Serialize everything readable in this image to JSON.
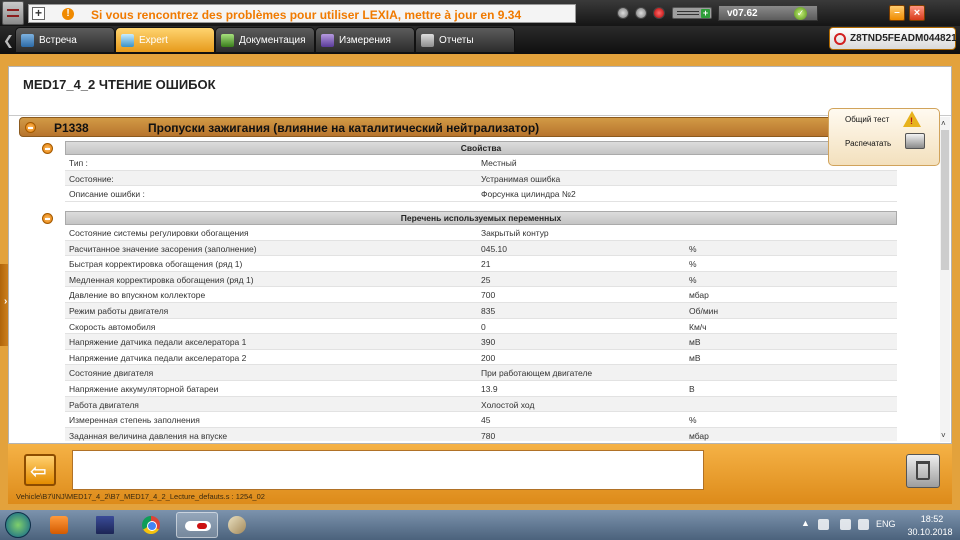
{
  "titlebar": {
    "message": "Si vous rencontrez des problèmes pour utiliser LEXIA, mettre à jour en 9.34",
    "version": "v07.62",
    "icons": [
      "plus-icon",
      "warning-icon",
      "cd-icon",
      "usb-icon",
      "record-icon",
      "battery-icon",
      "check-icon",
      "minimize-icon",
      "close-icon"
    ]
  },
  "tabs": [
    {
      "label": "Встреча",
      "icon": "meeting-icon",
      "active": false
    },
    {
      "label": "Expert",
      "icon": "expert-icon",
      "active": true
    },
    {
      "label": "Документация",
      "icon": "book-icon",
      "active": false
    },
    {
      "label": "Измерения",
      "icon": "measure-icon",
      "active": false
    },
    {
      "label": "Отчеты",
      "icon": "report-icon",
      "active": false
    }
  ],
  "vin": "Z8TND5FEADM044821",
  "page": {
    "title": "MED17_4_2 ЧТЕНИЕ ОШИБОК"
  },
  "actions": {
    "general_test": "Общий тест",
    "print": "Распечатать"
  },
  "fault": {
    "code": "P1338",
    "description": "Пропуски зажигания (влияние на каталитический нейтрализатор)"
  },
  "properties": {
    "header": "Свойства",
    "rows": [
      {
        "name": "Тип :",
        "value": "Местный"
      },
      {
        "name": "Состояние:",
        "value": "Устранимая ошибка"
      },
      {
        "name": "Описание ошибки :",
        "value": "Форсунка цилиндра №2"
      }
    ]
  },
  "variables": {
    "header": "Перечень используемых переменных",
    "rows": [
      {
        "name": "Состояние системы регулировки обогащения",
        "value": "Закрытый контур",
        "unit": ""
      },
      {
        "name": "Расчитанное значение засорения (заполнение)",
        "value": "045.10",
        "unit": "%"
      },
      {
        "name": "Быстрая корректировка обогащения (ряд 1)",
        "value": "21",
        "unit": "%"
      },
      {
        "name": "Медленная корректировка обогащения (ряд 1)",
        "value": "25",
        "unit": "%"
      },
      {
        "name": "Давление во впускном коллекторе",
        "value": "700",
        "unit": "мбар"
      },
      {
        "name": "Режим работы двигателя",
        "value": "835",
        "unit": "Об/мин"
      },
      {
        "name": "Скорость автомобиля",
        "value": "0",
        "unit": "Км/ч"
      },
      {
        "name": "Напряжение датчика педали акселератора 1",
        "value": "390",
        "unit": "мВ"
      },
      {
        "name": "Напряжение датчика педали акселератора 2",
        "value": "200",
        "unit": "мВ"
      },
      {
        "name": "Состояние двигателя",
        "value": "При работающем двигателе",
        "unit": ""
      },
      {
        "name": "Напряжение аккумуляторной батареи",
        "value": "13.9",
        "unit": "В"
      },
      {
        "name": "Работа двигателя",
        "value": "Холостой ход",
        "unit": ""
      },
      {
        "name": "Измеренная степень заполнения",
        "value": "45",
        "unit": "%"
      },
      {
        "name": "Заданная величина давления на впуске",
        "value": "780",
        "unit": "мбар"
      }
    ]
  },
  "bottom": {
    "path": "Vehicle\\B7\\INJ\\MED17_4_2\\B7_MED17_4_2_Lecture_defauts.s : 1254_02"
  },
  "taskbar": {
    "apps": [
      "media-player-icon",
      "save-disk-icon",
      "chrome-icon",
      "lexia-icon",
      "paint-icon"
    ],
    "language": "ENG",
    "time": "18:52",
    "date": "30.10.2018"
  },
  "colors": {
    "accent_orange": "#e79a1b",
    "fault_bar": "#c8883a",
    "warning_text": "#f07a00"
  }
}
